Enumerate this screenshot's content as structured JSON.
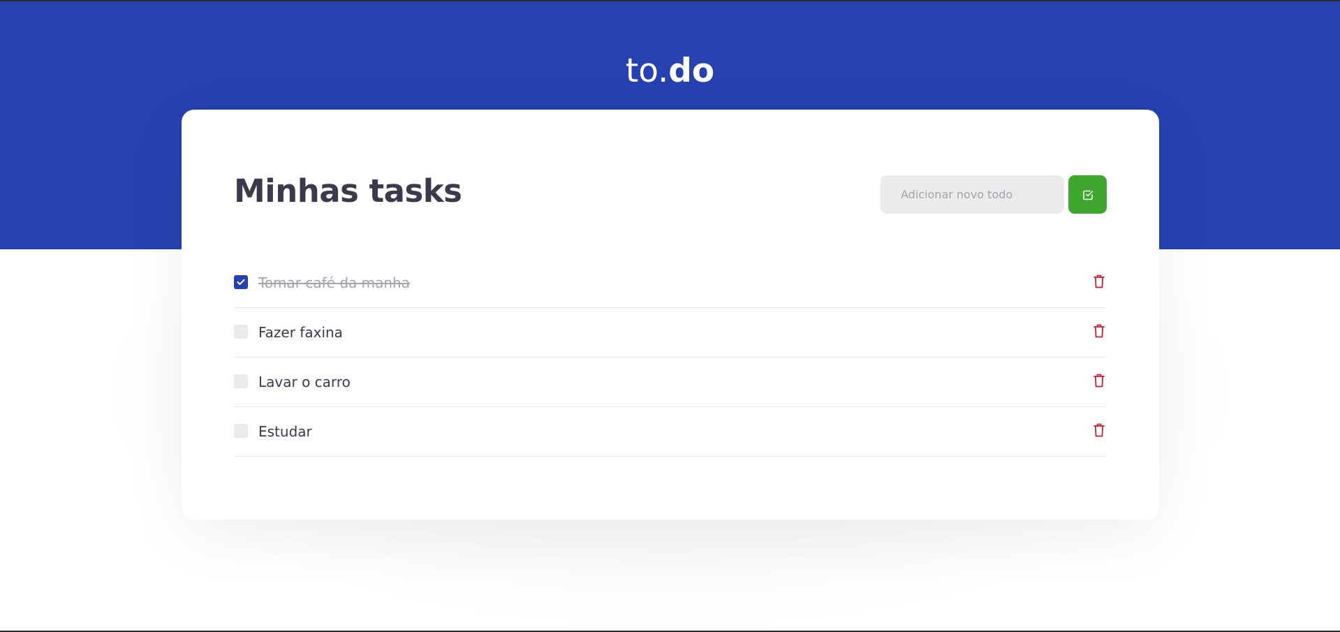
{
  "app": {
    "logo_light": "to.",
    "logo_bold": "do"
  },
  "colors": {
    "brand_blue": "#2641b0",
    "add_green": "#3ea72d",
    "delete_red": "#c51f33",
    "title_text": "#3a3a4c"
  },
  "main": {
    "title": "Minhas tasks",
    "new_todo": {
      "placeholder": "Adicionar novo todo",
      "value": ""
    },
    "add_button_icon": "check-square-icon",
    "tasks": [
      {
        "label": "Tomar café da manha",
        "completed": true,
        "delete_icon": "trash-icon"
      },
      {
        "label": "Fazer faxina",
        "completed": false,
        "delete_icon": "trash-icon"
      },
      {
        "label": "Lavar o carro",
        "completed": false,
        "delete_icon": "trash-icon"
      },
      {
        "label": "Estudar",
        "completed": false,
        "delete_icon": "trash-icon"
      }
    ]
  }
}
